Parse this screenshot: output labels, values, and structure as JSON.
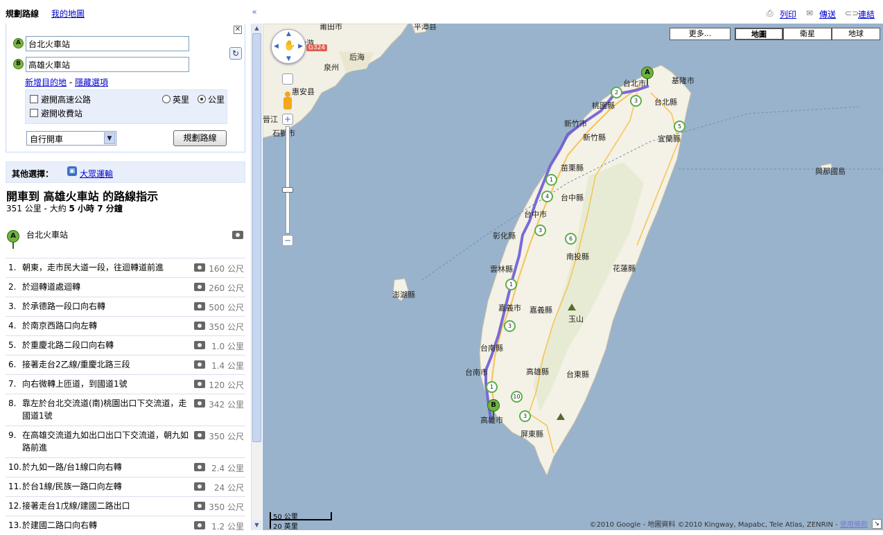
{
  "sidebar": {
    "tab_route": "規劃路線",
    "tab_mymaps": "我的地圖",
    "collapse_icon": "«",
    "close_icon": "✕",
    "swap_icon": "↻",
    "from_marker": "A",
    "to_marker": "B",
    "from_value": "台北火車站",
    "to_value": "高雄火車站",
    "add_destination": "新增目的地",
    "link_sep": " - ",
    "hide_options": "隱藏選項",
    "avoid_highways": "避開高速公路",
    "avoid_tolls": "避開收費站",
    "unit_miles": "英里",
    "unit_km": "公里",
    "travel_mode": "自行開車",
    "get_directions": "規劃路線",
    "other_options_label": "其他選擇：",
    "transit_link": "大眾運輸",
    "route_title": "開車到 高雄火車站 的路線指示",
    "route_distance": "351 公里",
    "route_sep": " - ",
    "route_time_label": "大約 ",
    "route_time_bold": "5 小時 7 分鐘",
    "start_name": "台北火車站",
    "steps": [
      {
        "n": "1.",
        "t": "朝東，走市民大道一段，往迴轉道前進",
        "d": "160 公尺"
      },
      {
        "n": "2.",
        "t": "於迴轉道處迴轉",
        "d": "260 公尺"
      },
      {
        "n": "3.",
        "t": "於承德路一段口向右轉",
        "d": "500 公尺"
      },
      {
        "n": "4.",
        "t": "於南京西路口向左轉",
        "d": "350 公尺"
      },
      {
        "n": "5.",
        "t": "於重慶北路二段口向右轉",
        "d": "1.0 公里"
      },
      {
        "n": "6.",
        "t": "接著走台2乙線/重慶北路三段",
        "d": "1.4 公里"
      },
      {
        "n": "7.",
        "t": "向右微轉上匝道，到國道1號",
        "d": "120 公尺"
      },
      {
        "n": "8.",
        "t": "靠左於台北交流道(南)桃園出口下交流道，走國道1號",
        "d": "342 公里"
      },
      {
        "n": "9.",
        "t": "在高雄交流道九如出口出口下交流道，朝九如路前進",
        "d": "350 公尺"
      },
      {
        "n": "10.",
        "t": "於九如一路/台1線口向右轉",
        "d": "2.4 公里"
      },
      {
        "n": "11.",
        "t": "於台1線/民族一路口向左轉",
        "d": "24 公尺"
      },
      {
        "n": "12.",
        "t": "接著走台1戊線/建國二路出口",
        "d": "350 公尺"
      },
      {
        "n": "13.",
        "t": "於建國二路口向右轉",
        "d": "1.2 公里"
      }
    ]
  },
  "map_header": {
    "print": "列印",
    "send": "傳送",
    "link": "連結"
  },
  "map": {
    "more_button": "更多...",
    "type_map": "地圖",
    "type_satellite": "衛星",
    "type_earth": "地球",
    "pan_icon": "✋",
    "zoom_in": "+",
    "zoom_out": "−",
    "marker_a": "A",
    "marker_b": "B",
    "scale_km": "50 公里",
    "scale_mi": "20 英里",
    "copyright": "©2010 Google - 地圖資料 ©2010 Kingway, Mapabc, Tele Atlas, ZENRIN - ",
    "terms": "使用條款",
    "highway_label": "G324",
    "labels": [
      {
        "t": "莆田市",
        "cls": "l1"
      },
      {
        "t": "平潭县",
        "cls": "l2"
      },
      {
        "t": "仙游",
        "cls": "l3"
      },
      {
        "t": "后海",
        "cls": "l4"
      },
      {
        "t": "泉州",
        "cls": "l5"
      },
      {
        "t": "惠安县",
        "cls": "l6"
      },
      {
        "t": "晉江",
        "cls": "l7"
      },
      {
        "t": "石獅市",
        "cls": "l8"
      },
      {
        "t": "台北市",
        "cls": "l9"
      },
      {
        "t": "基隆市",
        "cls": "l10"
      },
      {
        "t": "台北縣",
        "cls": "l11"
      },
      {
        "t": "桃園縣",
        "cls": "l12"
      },
      {
        "t": "新竹市",
        "cls": "l13"
      },
      {
        "t": "新竹縣",
        "cls": "l14"
      },
      {
        "t": "宜蘭縣",
        "cls": "l15"
      },
      {
        "t": "與那國島",
        "cls": "l16"
      },
      {
        "t": "苗栗縣",
        "cls": "l17"
      },
      {
        "t": "台中縣",
        "cls": "l18"
      },
      {
        "t": "台中市",
        "cls": "l19"
      },
      {
        "t": "彰化縣",
        "cls": "l20"
      },
      {
        "t": "南投縣",
        "cls": "l21"
      },
      {
        "t": "花蓮縣",
        "cls": "l22"
      },
      {
        "t": "雲林縣",
        "cls": "l23"
      },
      {
        "t": "澎湖縣",
        "cls": "l24"
      },
      {
        "t": "嘉義市",
        "cls": "l25"
      },
      {
        "t": "嘉義縣",
        "cls": "l26"
      },
      {
        "t": "玉山",
        "cls": "l27"
      },
      {
        "t": "台南縣",
        "cls": "l28"
      },
      {
        "t": "台南市",
        "cls": "l29"
      },
      {
        "t": "高雄縣",
        "cls": "l30"
      },
      {
        "t": "台東縣",
        "cls": "l31"
      },
      {
        "t": "高雄市",
        "cls": "l32"
      },
      {
        "t": "屏東縣",
        "cls": "l33"
      }
    ],
    "shields": [
      "2",
      "3",
      "5",
      "1",
      "4",
      "3",
      "6",
      "1",
      "3",
      "1",
      "10",
      "3"
    ]
  }
}
